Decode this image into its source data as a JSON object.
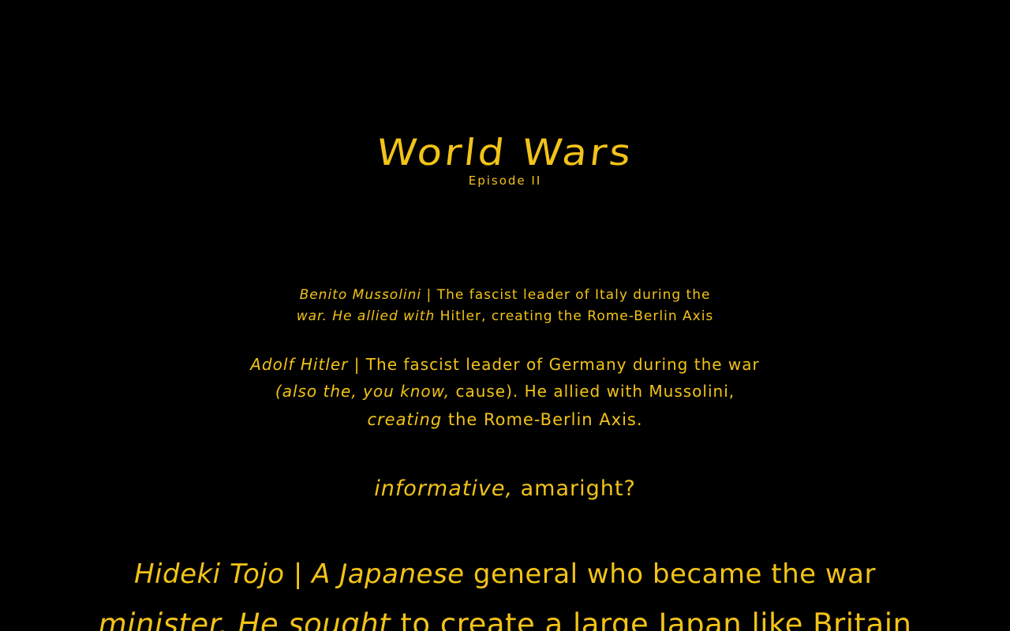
{
  "crawl": {
    "title": "World Wars",
    "subtitle": "Episode II",
    "lines": [
      {
        "italic": "Benito Mussolini",
        "rest": " | The fascist leader of Italy during the"
      },
      {
        "italic": "war.  He allied with",
        "rest": " Hitler, creating the Rome-Berlin Axis"
      },
      {
        "italic": "Adolf Hitler",
        "rest": " | The fascist leader of Germany during the war"
      },
      {
        "italic": "(also the, you know,",
        "rest": " cause).  He allied with Mussolini,"
      },
      {
        "italic": "creating",
        "rest": " the Rome-Berlin Axis."
      },
      {
        "italic": "informative,",
        "rest": " amaright?"
      },
      {
        "italic": "Hideki Tojo | A Japanese",
        "rest": " general who became the war"
      },
      {
        "italic": "minister.  He sought",
        "rest": " to create a large Japan like Britain"
      }
    ]
  },
  "colors": {
    "background": "#000000",
    "text": "#f2c318"
  }
}
